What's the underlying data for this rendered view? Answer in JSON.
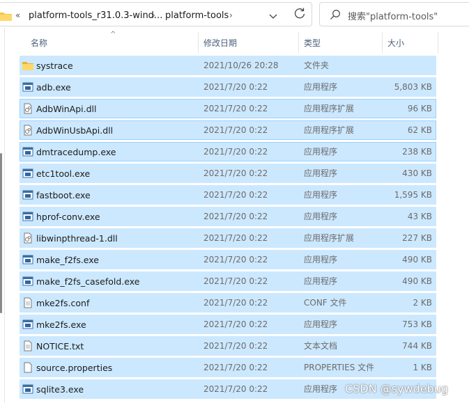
{
  "address": {
    "overflow": "«",
    "crumbs": [
      "platform-tools_r31.0.3-wind...",
      "platform-tools"
    ]
  },
  "search": {
    "placeholder": "搜索\"platform-tools\""
  },
  "columns": {
    "name": "名称",
    "date": "修改日期",
    "type": "类型",
    "size": "大小"
  },
  "files": [
    {
      "name": "systrace",
      "date": "2021/10/26 20:28",
      "type": "文件夹",
      "size": "",
      "icon": "folder-icon"
    },
    {
      "name": "adb.exe",
      "date": "2021/7/20 0:22",
      "type": "应用程序",
      "size": "5,803 KB",
      "icon": "exe-icon"
    },
    {
      "name": "AdbWinApi.dll",
      "date": "2021/7/20 0:22",
      "type": "应用程序扩展",
      "size": "96 KB",
      "icon": "dll-icon"
    },
    {
      "name": "AdbWinUsbApi.dll",
      "date": "2021/7/20 0:22",
      "type": "应用程序扩展",
      "size": "62 KB",
      "icon": "dll-icon"
    },
    {
      "name": "dmtracedump.exe",
      "date": "2021/7/20 0:22",
      "type": "应用程序",
      "size": "238 KB",
      "icon": "exe-icon"
    },
    {
      "name": "etc1tool.exe",
      "date": "2021/7/20 0:22",
      "type": "应用程序",
      "size": "430 KB",
      "icon": "exe-icon"
    },
    {
      "name": "fastboot.exe",
      "date": "2021/7/20 0:22",
      "type": "应用程序",
      "size": "1,595 KB",
      "icon": "exe-icon"
    },
    {
      "name": "hprof-conv.exe",
      "date": "2021/7/20 0:22",
      "type": "应用程序",
      "size": "43 KB",
      "icon": "exe-icon"
    },
    {
      "name": "libwinpthread-1.dll",
      "date": "2021/7/20 0:22",
      "type": "应用程序扩展",
      "size": "227 KB",
      "icon": "dll-icon"
    },
    {
      "name": "make_f2fs.exe",
      "date": "2021/7/20 0:22",
      "type": "应用程序",
      "size": "490 KB",
      "icon": "exe-icon"
    },
    {
      "name": "make_f2fs_casefold.exe",
      "date": "2021/7/20 0:22",
      "type": "应用程序",
      "size": "490 KB",
      "icon": "exe-icon"
    },
    {
      "name": "mke2fs.conf",
      "date": "2021/7/20 0:22",
      "type": "CONF 文件",
      "size": "2 KB",
      "icon": "text-file-icon"
    },
    {
      "name": "mke2fs.exe",
      "date": "2021/7/20 0:22",
      "type": "应用程序",
      "size": "753 KB",
      "icon": "exe-icon"
    },
    {
      "name": "NOTICE.txt",
      "date": "2021/7/20 0:22",
      "type": "文本文档",
      "size": "744 KB",
      "icon": "text-file-icon"
    },
    {
      "name": "source.properties",
      "date": "2021/7/20 0:22",
      "type": "PROPERTIES 文件",
      "size": "1 KB",
      "icon": "blank-file-icon"
    },
    {
      "name": "sqlite3.exe",
      "date": "2021/7/20 0:22",
      "type": "应用程序",
      "size": "",
      "icon": "exe-icon"
    }
  ],
  "watermark": "CSDN @sywdebug",
  "colors": {
    "selection": "#cce8ff",
    "selection_border": "#99d1ff",
    "folder": "#f4c542"
  }
}
